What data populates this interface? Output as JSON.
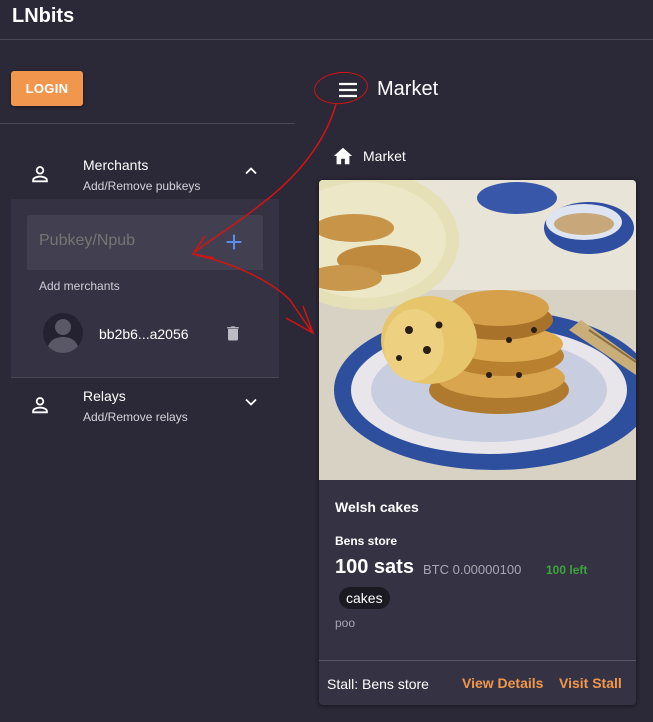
{
  "app": {
    "brand": "LNbits"
  },
  "auth": {
    "login_label": "LOGIN"
  },
  "sidebar": {
    "merchants": {
      "title": "Merchants",
      "subtitle": "Add/Remove pubkeys",
      "input_placeholder": "Pubkey/Npub",
      "add_hint": "Add merchants",
      "items": [
        {
          "key": "bb2b6...a2056"
        }
      ]
    },
    "relays": {
      "title": "Relays",
      "subtitle": "Add/Remove relays"
    }
  },
  "header": {
    "title": "Market"
  },
  "breadcrumb": {
    "label": "Market"
  },
  "product": {
    "name": "Welsh cakes",
    "stall": "Bens store",
    "price": "100 sats",
    "btc": "BTC 0.00000100",
    "stock": "100 left",
    "tags": [
      "cakes"
    ],
    "description": "poo",
    "stall_label": "Stall: Bens store",
    "view_label": "View Details",
    "visit_label": "Visit Stall"
  },
  "icons": {
    "person": "person-icon",
    "chevron_up": "chevron-up-icon",
    "chevron_down": "chevron-down-icon",
    "plus": "plus-icon",
    "trash": "trash-icon",
    "menu": "menu-icon",
    "home": "home-icon"
  },
  "colors": {
    "background": "#2b2837",
    "panel": "#353343",
    "accent": "#f1974d",
    "primary_icon": "#5b8dee",
    "success": "#3ca43c",
    "annotation": "#d31414"
  }
}
